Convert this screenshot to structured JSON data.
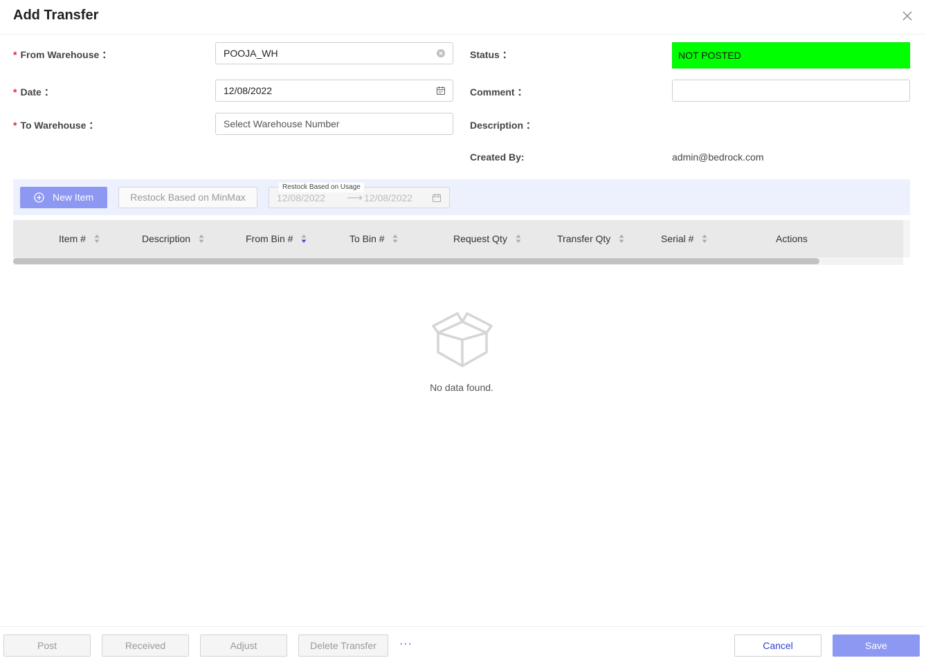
{
  "dialog": {
    "title": "Add Transfer"
  },
  "form": {
    "from_warehouse": {
      "label": "From Warehouse",
      "value": "POOJA_WH"
    },
    "date": {
      "label": "Date",
      "value": "12/08/2022"
    },
    "to_warehouse": {
      "label": "To Warehouse",
      "placeholder": "Select Warehouse Number"
    },
    "status": {
      "label": "Status",
      "value": "NOT POSTED",
      "color": "#00ff00"
    },
    "comment": {
      "label": "Comment",
      "value": ""
    },
    "description": {
      "label": "Description"
    },
    "created_by": {
      "label": "Created By",
      "value": "admin@bedrock.com"
    },
    "colon": "："
  },
  "toolbar": {
    "new_item": "New Item",
    "restock_minmax": "Restock Based on MinMax",
    "restock_usage_legend": "Restock Based on Usage",
    "range_start": "12/08/2022",
    "range_end": "12/08/2022"
  },
  "table": {
    "columns": [
      "Item #",
      "Description",
      "From Bin #",
      "To Bin #",
      "Request Qty",
      "Transfer Qty",
      "Serial #",
      "Actions"
    ],
    "empty_text": "No data found."
  },
  "footer": {
    "post": "Post",
    "received": "Received",
    "adjust": "Adjust",
    "delete_transfer": "Delete Transfer",
    "more": "···",
    "cancel": "Cancel",
    "save": "Save"
  },
  "colors": {
    "accent": "#8d98f2",
    "link": "#2f3fd0",
    "required": "#e0282e"
  }
}
